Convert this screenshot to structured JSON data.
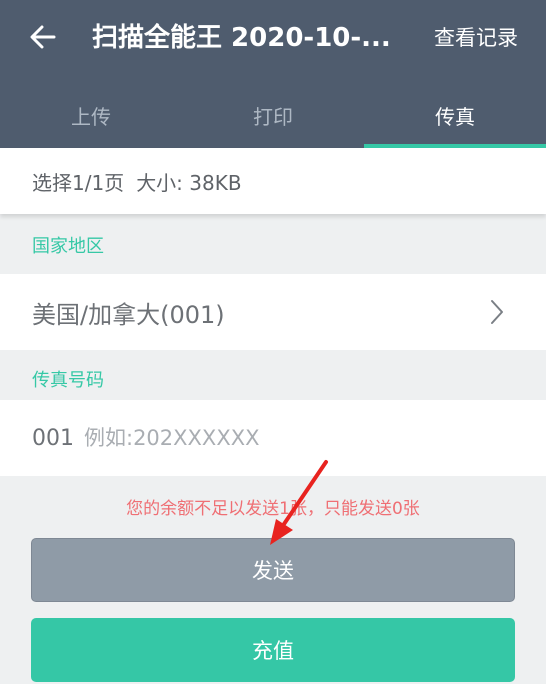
{
  "header": {
    "title": "扫描全能王 2020-10-...",
    "history_label": "查看记录",
    "back_icon": "arrow-left-icon"
  },
  "tabs": [
    {
      "label": "上传",
      "active": false
    },
    {
      "label": "打印",
      "active": false
    },
    {
      "label": "传真",
      "active": true
    }
  ],
  "selection": {
    "pages": "选择1/1页",
    "size": "大小: 38KB"
  },
  "country": {
    "section_label": "国家地区",
    "value": "美国/加拿大(001)",
    "chevron_icon": "chevron-right-icon"
  },
  "fax": {
    "section_label": "传真号码",
    "prefix": "001",
    "placeholder": "例如:202XXXXXX"
  },
  "warning": "您的余额不足以发送1张，只能发送0张",
  "buttons": {
    "send": "发送",
    "recharge": "充值"
  },
  "colors": {
    "header_bg": "#4f5c6e",
    "accent": "#36c8a6",
    "warning": "#ef6f74",
    "send_bg": "#8f9ba7"
  }
}
